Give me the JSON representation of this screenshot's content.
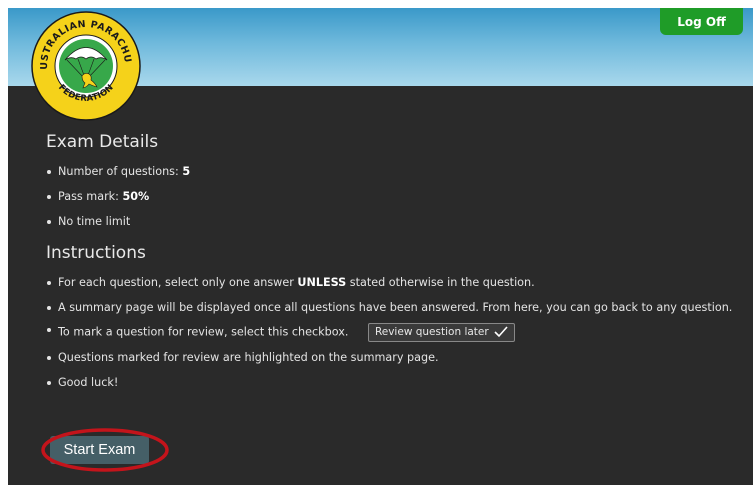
{
  "header": {
    "logo_top_text": "AUSTRALIAN PARACHUTE",
    "logo_bottom_text": "FEDERATION",
    "logoff_label": "Log Off"
  },
  "exam_details": {
    "title": "Exam Details",
    "questions_label": "Number of questions: ",
    "questions_value": "5",
    "pass_label": "Pass mark: ",
    "pass_value": "50%",
    "time_limit": "No time limit"
  },
  "instructions": {
    "title": "Instructions",
    "item1_before": "For each question, select only one answer ",
    "item1_bold": "UNLESS",
    "item1_after": " stated otherwise in the question.",
    "item2": "A summary page will be displayed once all questions have been answered. From here, you can go back to any question.",
    "item3": "To mark a question for review, select this checkbox.",
    "review_checkbox_label": "Review question later",
    "review_checked": true,
    "item4": "Questions marked for review are highlighted on the summary page.",
    "item5": "Good luck!"
  },
  "start_button": {
    "label": "Start Exam",
    "highlight_color": "#c4141b"
  },
  "colors": {
    "background": "#2a2a2a",
    "header_sky": "#6fb9dc",
    "logoff_green": "#1f9c28",
    "button": "#455f67",
    "logo_yellow": "#f5d21a",
    "logo_green": "#37a84a"
  }
}
